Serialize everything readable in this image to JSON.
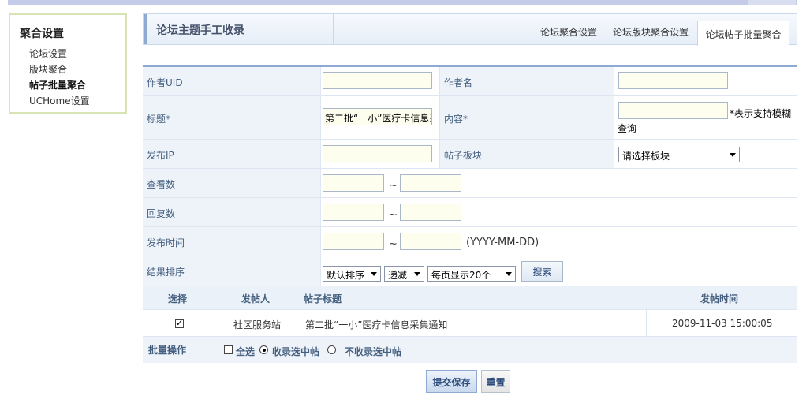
{
  "sidebar": {
    "title": "聚合设置",
    "items": [
      {
        "label": "论坛设置"
      },
      {
        "label": "版块聚合"
      },
      {
        "label": "帖子批量聚合"
      },
      {
        "label": "UCHome设置"
      }
    ]
  },
  "header": {
    "title": "论坛主题手工收录",
    "tabs": [
      {
        "label": "论坛聚合设置"
      },
      {
        "label": "论坛版块聚合设置"
      },
      {
        "label": "论坛帖子批量聚合"
      }
    ]
  },
  "form": {
    "author_uid_label": "作者UID",
    "author_name_label": "作者名",
    "title_label": "标题*",
    "title_value": "第二批“一小”医疗卡信息采集通知",
    "content_label": "内容*",
    "fuzzy_hint": "*表示支持模糊查询",
    "ip_label": "发布IP",
    "forum_label": "帖子板块",
    "forum_select": "请选择板块",
    "views_label": "查看数",
    "replies_label": "回复数",
    "time_label": "发布时间",
    "time_format": "(YYYY-MM-DD)",
    "tilde": "~",
    "sort_label": "结果排序",
    "sort_select": "默认排序",
    "order_select": "递减",
    "page_select": "每页显示20个",
    "search_button": "搜索"
  },
  "results": {
    "headers": {
      "select": "选择",
      "author": "发帖人",
      "title": "帖子标题",
      "time": "发帖时间"
    },
    "rows": [
      {
        "checked": true,
        "author": "社区服务站",
        "title": "第二批“一小”医疗卡信息采集通知",
        "time": "2009-11-03 15:00:05"
      }
    ]
  },
  "batch": {
    "label": "批量操作",
    "select_all": "全选",
    "collect": "收录选中帖",
    "no_collect": "不收录选中帖"
  },
  "actions": {
    "submit": "提交保存",
    "reset": "重置"
  }
}
